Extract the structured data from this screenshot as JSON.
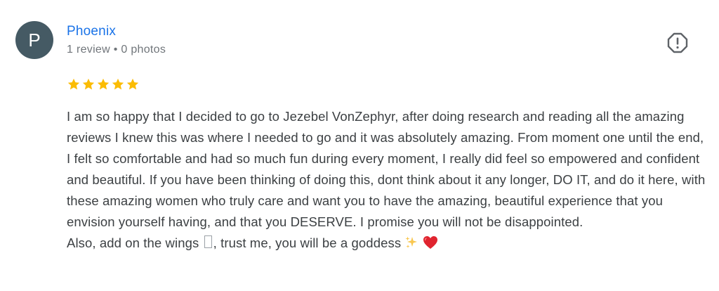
{
  "reviewer": {
    "initial": "P",
    "name": "Phoenix",
    "meta": "1 review • 0 photos",
    "avatar_color": "#455a64"
  },
  "rating": {
    "stars": 5,
    "max": 5,
    "star_color": "#fbbc04"
  },
  "review": {
    "body": "I am so happy that I decided to go to Jezebel VonZephyr, after doing research and reading all the amazing reviews I knew this was where I needed to go and it was absolutely amazing. From moment one until the end, I felt so comfortable and had so much fun during every moment, I really did feel so empowered and confident and beautiful. If you have been thinking of doing this, dont think about it any longer, DO IT, and do it here, with these amazing women who truly care and want you to have the amazing, beautiful experience that you envision yourself having, and that you DESERVE. I promise you will not be disappointed.",
    "line2_start": "Also, add on the wings",
    "line2_mid": ", trust me, you will be a goddess"
  },
  "icons": {
    "report": "report-flag-icon",
    "star": "star-icon",
    "missing_glyph": "missing-glyph-icon",
    "sparkles": "sparkles-icon",
    "heart": "heart-icon"
  },
  "colors": {
    "name_link": "#1a73e8",
    "meta_text": "#70757a",
    "body_text": "#3c4043"
  }
}
